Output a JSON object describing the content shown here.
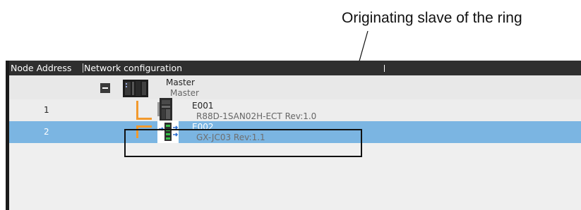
{
  "callout": {
    "text": "Originating slave of the ring"
  },
  "table": {
    "header": {
      "address": "Node Address",
      "network": "Network configuration"
    },
    "master": {
      "name": "Master",
      "subtitle": "Master"
    },
    "rows": [
      {
        "address": "1",
        "name": "E001",
        "model": "R88D-1SAN02H-ECT Rev:1.0",
        "selected": false
      },
      {
        "address": "2",
        "name": "E002",
        "model": "GX-JC03 Rev:1.1",
        "selected": true
      }
    ]
  },
  "colors": {
    "header_bg": "#2f2f2f",
    "selected_row": "#7bb5e2",
    "wire": "#f29a2e",
    "panel_bg": "#f0f0f0"
  },
  "icons": [
    "collapse-icon",
    "controller-icon",
    "servo-drive-icon",
    "junction-slave-icon"
  ]
}
